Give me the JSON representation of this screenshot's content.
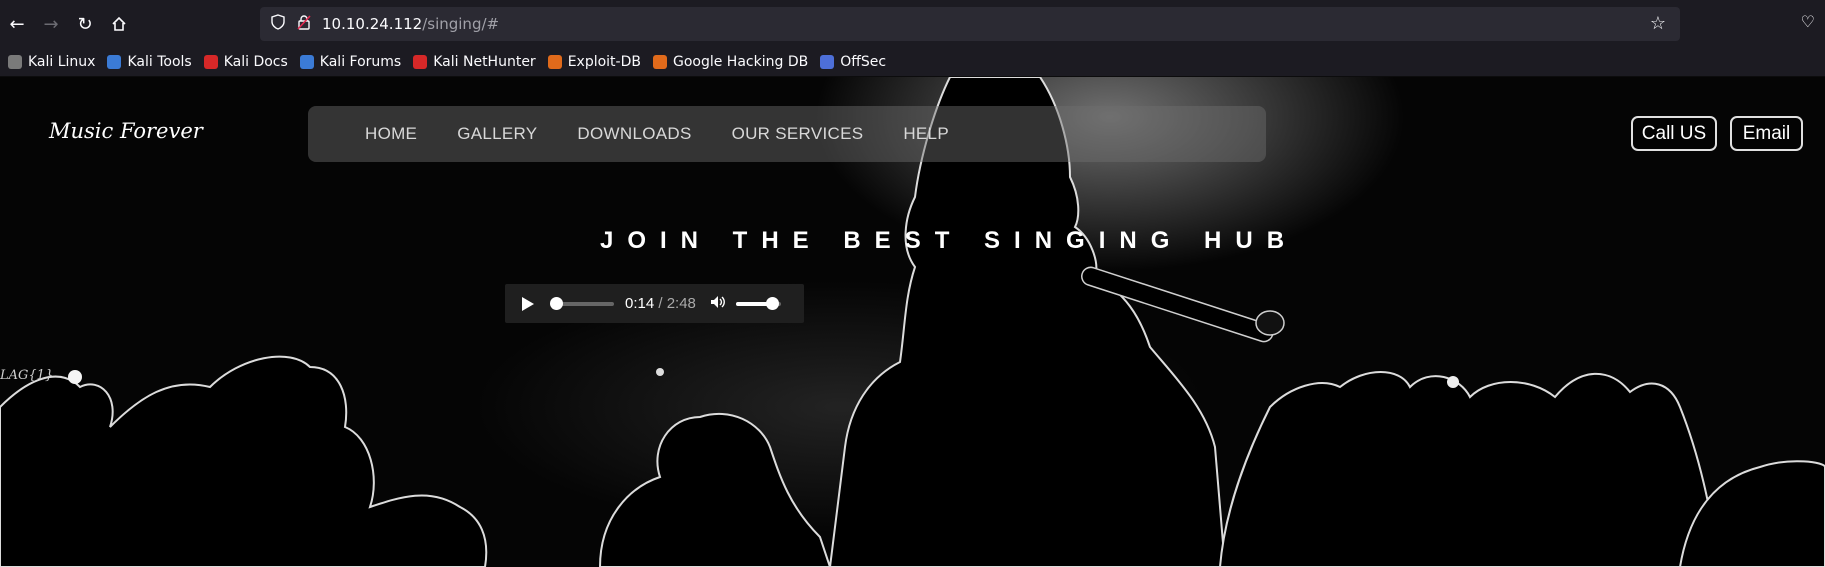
{
  "browser": {
    "url_host": "10.10.24.112",
    "url_path": "/singing/#",
    "bookmarks": [
      {
        "label": "Kali Linux",
        "icon": "kali-dragon-icon",
        "color": "#7a7a7a"
      },
      {
        "label": "Kali Tools",
        "icon": "kali-tools-icon",
        "color": "#3b7bd6"
      },
      {
        "label": "Kali Docs",
        "icon": "kali-docs-icon",
        "color": "#d62828"
      },
      {
        "label": "Kali Forums",
        "icon": "kali-forums-icon",
        "color": "#3b7bd6"
      },
      {
        "label": "Kali NetHunter",
        "icon": "kali-nethunter-icon",
        "color": "#d62828"
      },
      {
        "label": "Exploit-DB",
        "icon": "exploit-db-icon",
        "color": "#e06a1b"
      },
      {
        "label": "Google Hacking DB",
        "icon": "ghdb-icon",
        "color": "#e06a1b"
      },
      {
        "label": "OffSec",
        "icon": "offsec-icon",
        "color": "#4d6fd8"
      }
    ]
  },
  "site": {
    "brand": "Music Forever",
    "nav": [
      "HOME",
      "GALLERY",
      "DOWNLOADS",
      "OUR SERVICES",
      "HELP"
    ],
    "call_button": "Call US",
    "email_button": "Email",
    "hero_title": "JOIN THE BEST SINGING HUB",
    "audio": {
      "current": "0:14",
      "duration": "/ 2:48",
      "progress_fraction": 0.083,
      "volume_fraction": 0.8
    },
    "flag_text": "LAG{1}"
  }
}
